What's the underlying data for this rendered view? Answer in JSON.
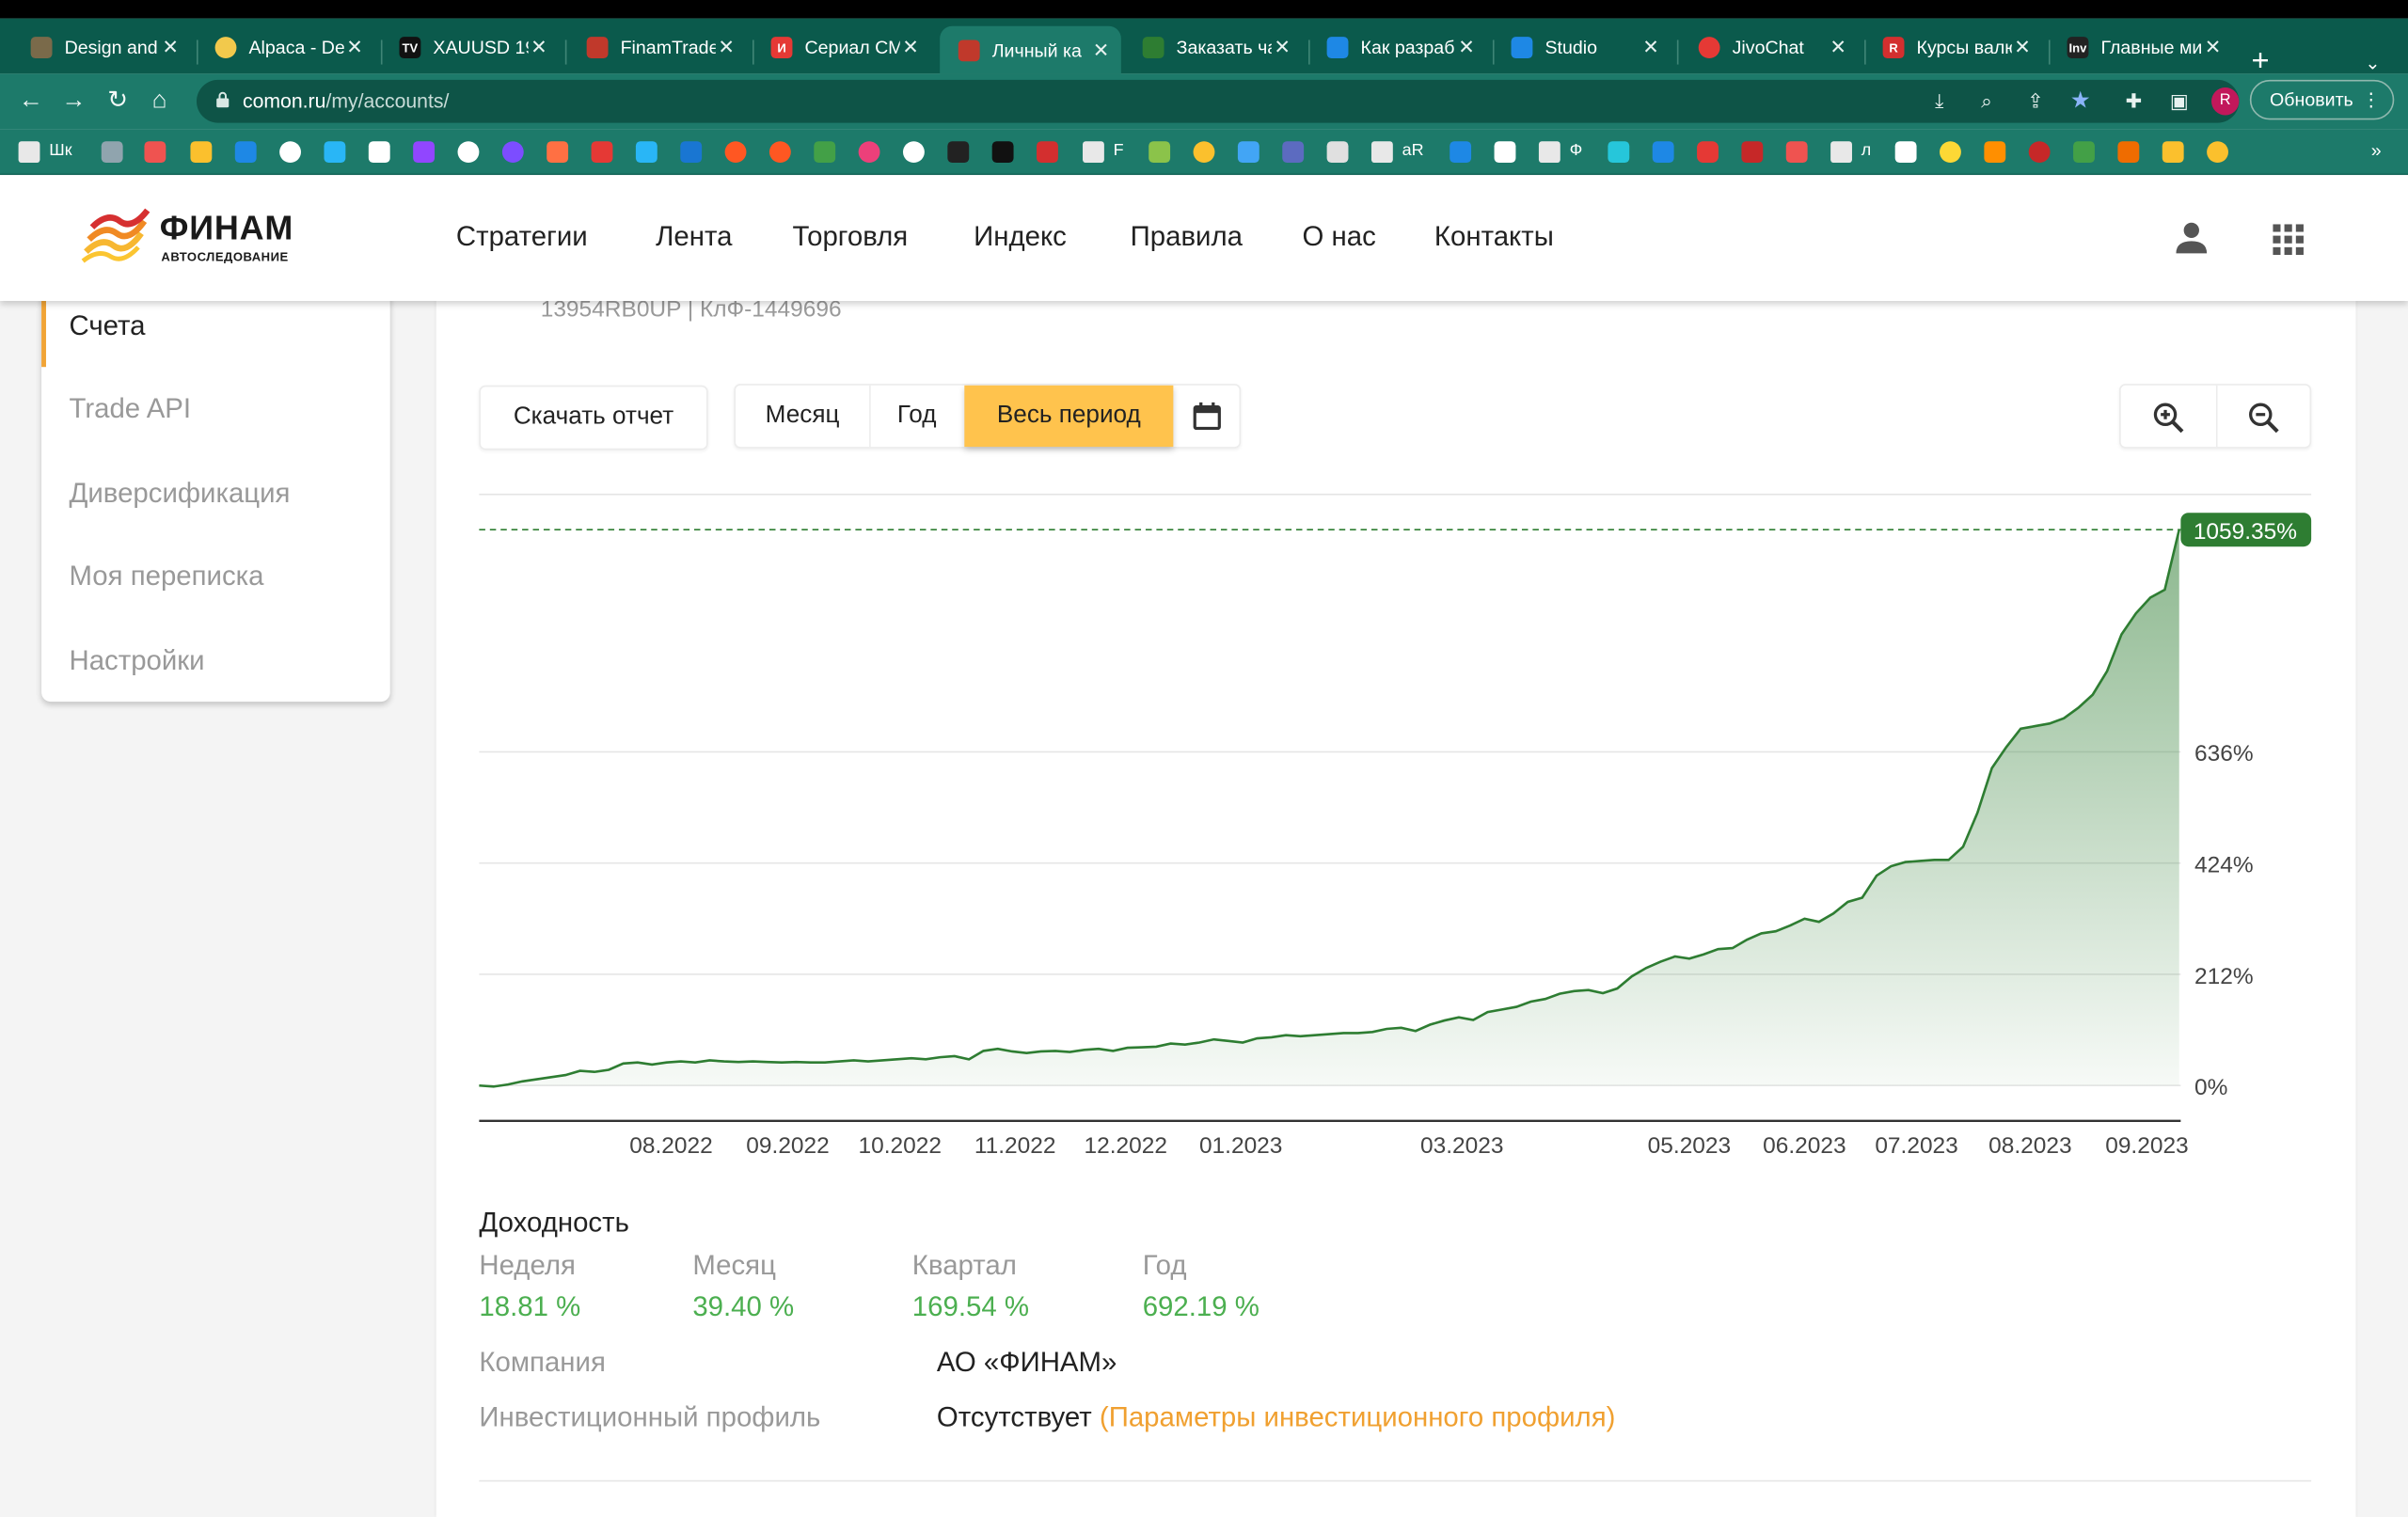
{
  "browser": {
    "tabs": [
      {
        "title": "Design and t",
        "icon": "design-icon",
        "color": "#7a6a4a"
      },
      {
        "title": "Alpaca - De",
        "icon": "alpaca-icon",
        "color": "#f2c94c"
      },
      {
        "title": "XAUUSD 19",
        "icon": "tradingview-icon",
        "color": "#111111"
      },
      {
        "title": "FinamTrade",
        "icon": "finam-icon",
        "color": "#c0392b"
      },
      {
        "title": "Сериал СМ",
        "icon": "kinopoisk-icon",
        "color": "#e53935"
      },
      {
        "title": "Личный ка",
        "icon": "finam-icon",
        "color": "#c0392b",
        "active": true
      },
      {
        "title": "Заказать ча",
        "icon": "bars-icon",
        "color": "#2e7d32"
      },
      {
        "title": "Как разраб",
        "icon": "bars-icon",
        "color": "#1e88e5"
      },
      {
        "title": "Studio",
        "icon": "bars-icon",
        "color": "#1e88e5"
      },
      {
        "title": "JivoChat",
        "icon": "jivo-icon",
        "color": "#e53935"
      },
      {
        "title": "Курсы валю",
        "icon": "r-icon",
        "color": "#d32f2f"
      },
      {
        "title": "Главные ми",
        "icon": "investing-icon",
        "color": "#222222"
      }
    ],
    "url_host": "comon.ru",
    "url_path": "/my/accounts/",
    "update_label": "Обновить",
    "profile_letter": "R",
    "bookmarks": {
      "folder1": "Шк",
      "folder2": "F",
      "folder3": "aR",
      "folder4": "Ф",
      "folder5": "л"
    }
  },
  "site": {
    "logo_name": "ФИНАМ",
    "logo_sub": "АВТОСЛЕДОВАНИЕ",
    "nav": [
      "Стратегии",
      "Лента",
      "Торговля",
      "Индекс",
      "Правила",
      "О нас",
      "Контакты"
    ]
  },
  "sidebar": {
    "items": [
      {
        "label": "Счета",
        "active": true
      },
      {
        "label": "Trade API"
      },
      {
        "label": "Диверсификация"
      },
      {
        "label": "Моя переписка"
      },
      {
        "label": "Настройки"
      }
    ]
  },
  "account": {
    "id_line": "13954RB0UP | КлФ-1449696"
  },
  "controls": {
    "download": "Скачать отчет",
    "periods": [
      "Месяц",
      "Год",
      "Весь период"
    ],
    "active_period": "Весь период"
  },
  "colors": {
    "accent": "#ffc34d",
    "line": "#2e7d32",
    "positive": "#4caf50",
    "link": "#f0a030"
  },
  "chart_data": {
    "type": "area",
    "x_ticks": [
      "08.2022",
      "09.2022",
      "10.2022",
      "11.2022",
      "12.2022",
      "01.2023",
      "03.2023",
      "05.2023",
      "06.2023",
      "07.2023",
      "08.2023",
      "09.2023"
    ],
    "y_ticks": [
      "0%",
      "212%",
      "424%",
      "636%"
    ],
    "y_tick_values": [
      0,
      212,
      424,
      636
    ],
    "last_value_label": "1059.35%",
    "series": [
      {
        "values": [
          0,
          -2,
          2,
          8,
          12,
          16,
          20,
          28,
          26,
          30,
          42,
          44,
          40,
          44,
          46,
          44,
          48,
          46,
          45,
          46,
          45,
          44,
          45,
          44,
          44,
          46,
          48,
          46,
          48,
          50,
          52,
          50,
          54,
          56,
          50,
          66,
          70,
          65,
          62,
          65,
          66,
          64,
          68,
          70,
          66,
          72,
          73,
          74,
          80,
          78,
          82,
          88,
          85,
          82,
          90,
          92,
          96,
          94,
          96,
          98,
          100,
          100,
          102,
          108,
          110,
          104,
          116,
          124,
          130,
          125,
          140,
          145,
          150,
          160,
          165,
          175,
          180,
          182,
          176,
          185,
          208,
          224,
          236,
          246,
          242,
          250,
          260,
          262,
          278,
          290,
          294,
          305,
          318,
          312,
          328,
          350,
          358,
          400,
          418,
          426,
          428,
          430,
          430,
          455,
          520,
          605,
          645,
          680,
          685,
          690,
          700,
          720,
          745,
          790,
          860,
          900,
          930,
          945,
          1059.35
        ]
      }
    ],
    "ylim": [
      0,
      1059.35
    ]
  },
  "stats": {
    "title": "Доходность",
    "items": [
      {
        "label": "Неделя",
        "value": "18.81 %"
      },
      {
        "label": "Месяц",
        "value": "39.40 %"
      },
      {
        "label": "Квартал",
        "value": "169.54 %"
      },
      {
        "label": "Год",
        "value": "692.19 %"
      }
    ],
    "company_label": "Компания",
    "company_value": "АО «ФИНАМ»",
    "profile_label": "Инвестиционный профиль",
    "profile_value": "Отсутствует",
    "profile_link": "(Параметры инвестиционного профиля)"
  }
}
